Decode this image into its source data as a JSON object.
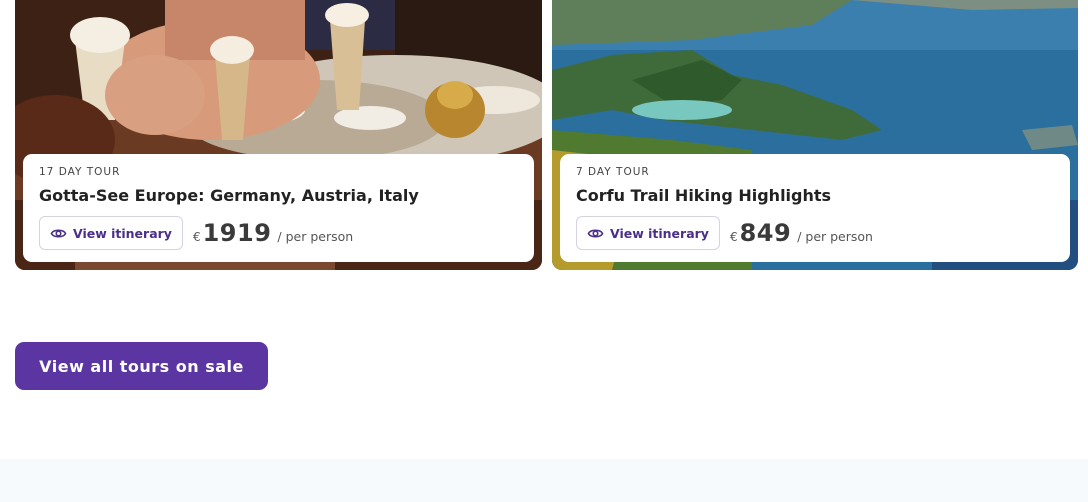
{
  "tours": [
    {
      "tag": "17 DAY TOUR",
      "title": "Gotta-See Europe: Germany, Austria, Italy",
      "itinerary_label": "View itinerary",
      "currency": "€",
      "price": "1919",
      "per_person": "/ per person"
    },
    {
      "tag": "7 DAY TOUR",
      "title": "Corfu Trail Hiking Highlights",
      "itinerary_label": "View itinerary",
      "currency": "€",
      "price": "849",
      "per_person": "/ per person"
    }
  ],
  "cta": {
    "label": "View all tours on sale"
  },
  "colors": {
    "accent": "#5b36a3",
    "link": "#4a2e88",
    "band": "#f6fafd"
  },
  "icons": {
    "itinerary": "eye-icon"
  }
}
